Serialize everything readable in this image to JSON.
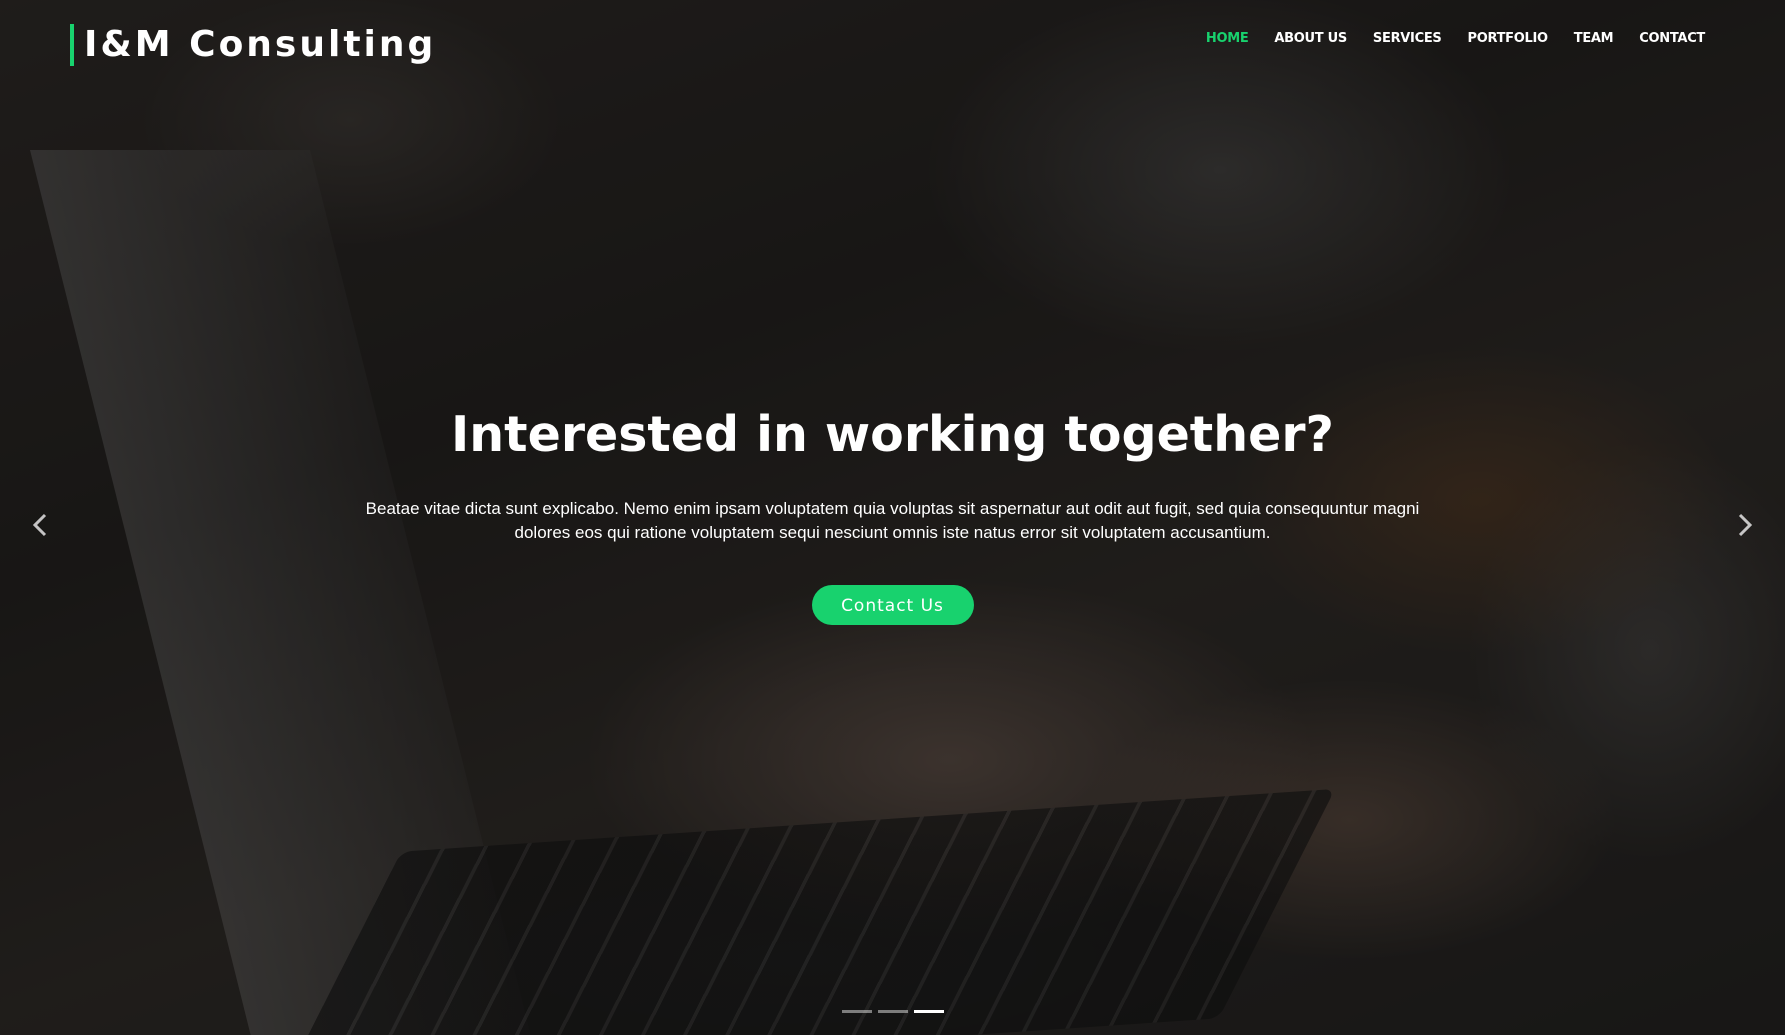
{
  "header": {
    "logo": "I&M Consulting",
    "nav": [
      {
        "label": "HOME",
        "active": true
      },
      {
        "label": "ABOUT US",
        "active": false
      },
      {
        "label": "SERVICES",
        "active": false
      },
      {
        "label": "PORTFOLIO",
        "active": false
      },
      {
        "label": "TEAM",
        "active": false
      },
      {
        "label": "CONTACT",
        "active": false
      }
    ]
  },
  "hero": {
    "title": "Interested in working together?",
    "description": "Beatae vitae dicta sunt explicabo. Nemo enim ipsam voluptatem quia voluptas sit aspernatur aut odit aut fugit, sed quia consequuntur magni dolores eos qui ratione voluptatem sequi nesciunt omnis iste natus error sit voluptatem accusantium.",
    "cta_label": "Contact Us"
  },
  "carousel": {
    "prev_icon": "chevron-left-icon",
    "next_icon": "chevron-right-icon",
    "slide_count": 3,
    "active_index": 2
  },
  "colors": {
    "accent": "#18d26e",
    "text": "#ffffff"
  }
}
